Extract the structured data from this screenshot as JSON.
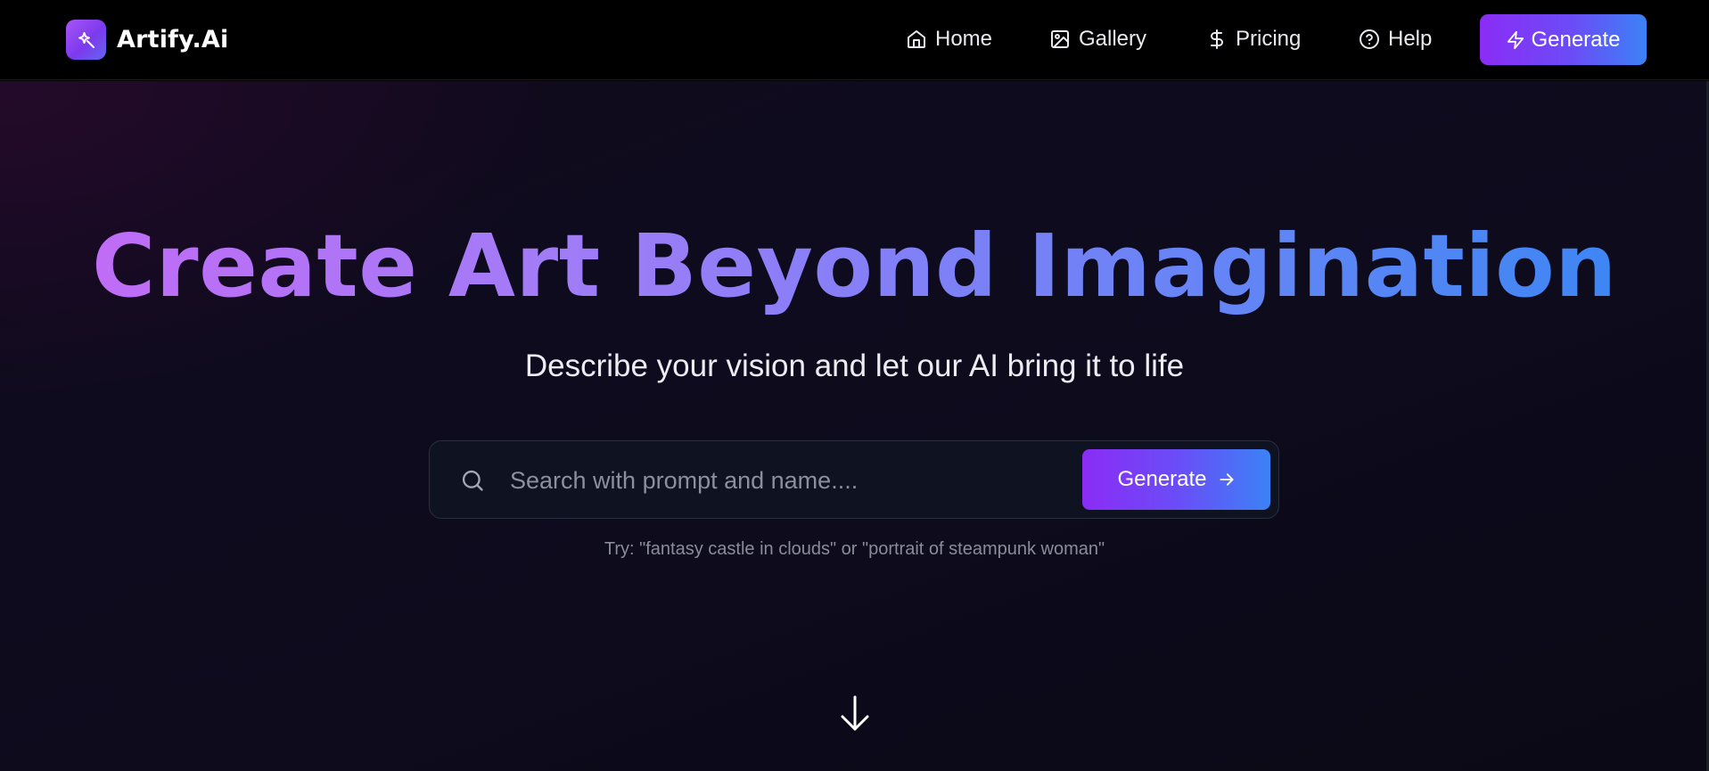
{
  "brand": {
    "name": "Artify.Ai",
    "logo_icon": "sparkle-wand-icon"
  },
  "nav": {
    "items": [
      {
        "label": "Home",
        "icon": "home-icon"
      },
      {
        "label": "Gallery",
        "icon": "gallery-icon"
      },
      {
        "label": "Pricing",
        "icon": "dollar-icon"
      },
      {
        "label": "Help",
        "icon": "help-circle-icon"
      }
    ],
    "cta_label": "Generate",
    "cta_icon": "lightning-icon"
  },
  "hero": {
    "title": "Create Art Beyond Imagination",
    "subtitle": "Describe your vision and let our AI bring it to life",
    "search": {
      "placeholder": "Search with prompt and name....",
      "value": "",
      "button_label": "Generate"
    },
    "hint": "Try: \"fantasy castle in clouds\" or \"portrait of steampunk woman\""
  },
  "colors": {
    "accent_start": "#8b2cf5",
    "accent_end": "#3b82f6",
    "title_gradient_start": "#c06cf6",
    "title_gradient_end": "#3d86f4",
    "background": "#0e0b1e"
  }
}
